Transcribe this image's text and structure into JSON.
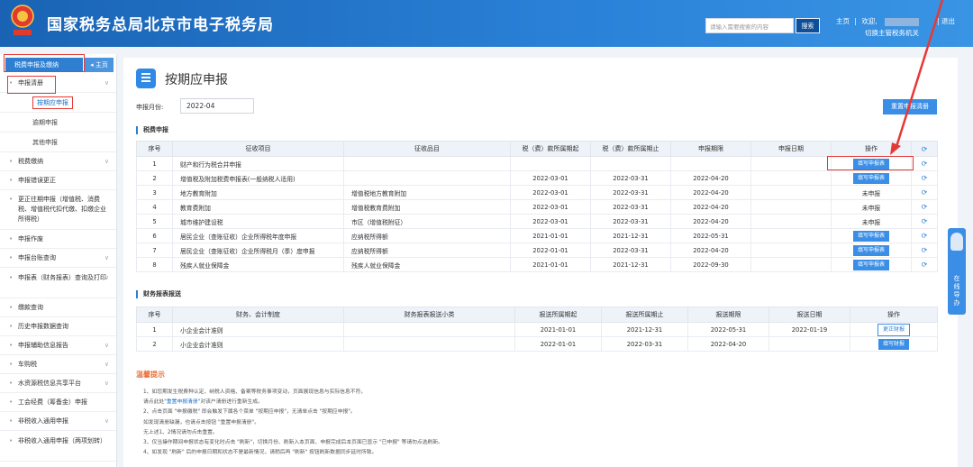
{
  "header": {
    "title": "国家税务总局北京市电子税务局",
    "emblem_text": "中国税务",
    "search_placeholder": "请输入需要搜索的内容",
    "search_button": "搜索",
    "home_link": "主页",
    "welcome": "欢迎,",
    "switch_role": "切换主管税务机关",
    "logout": "退出"
  },
  "sidebar": {
    "main_tab": "税费申报及缴纳",
    "home_tab": "主页",
    "items": [
      {
        "label": "申报清册",
        "expandable": true
      },
      {
        "label": "税费缴纳",
        "expandable": true
      },
      {
        "label": "申报错误更正",
        "expandable": false
      },
      {
        "label": "更正往期申报（增值税、消费税、增值税代扣代缴、扣缴企业所得税）",
        "expandable": false
      },
      {
        "label": "申报作废",
        "expandable": false
      },
      {
        "label": "申报台账查询",
        "expandable": true
      },
      {
        "label": "申报表（财务报表）查询及打印",
        "expandable": true
      },
      {
        "label": "缴款查询",
        "expandable": false
      },
      {
        "label": "历史申报数据查询",
        "expandable": false
      },
      {
        "label": "申报辅助信息报告",
        "expandable": true
      },
      {
        "label": "车购税",
        "expandable": true
      },
      {
        "label": "水资源税信息共享平台",
        "expandable": true
      },
      {
        "label": "工会经费（筹备金）申报",
        "expandable": false
      },
      {
        "label": "非税收入通用申报",
        "expandable": true
      },
      {
        "label": "非税收入通用申报（两项划转）",
        "expandable": false
      }
    ],
    "subitems": [
      "按期应申报",
      "逾期申报",
      "其他申报"
    ],
    "active_subitem": "按期应申报"
  },
  "main": {
    "page_title": "按期应申报",
    "month_label": "申报月份:",
    "month_value": "2022-04",
    "reset_button": "重置申报清册",
    "tax_section_title": "税费申报",
    "tax_table": {
      "headers": [
        "序号",
        "征收项目",
        "征收品目",
        "税（费）款所属期起",
        "税（费）款所属期止",
        "申报期限",
        "申报日期",
        "操作"
      ],
      "rows": [
        {
          "no": "1",
          "item": "财产和行为税合并申报",
          "sub": "",
          "start": "",
          "end": "",
          "deadline": "",
          "date": "",
          "op": "填写申报表",
          "op_type": "button"
        },
        {
          "no": "2",
          "item": "增值税及附加税费申报表(一般纳税人适用)",
          "sub": "",
          "start": "2022-03-01",
          "end": "2022-03-31",
          "deadline": "2022-04-20",
          "date": "",
          "op": "填写申报表",
          "op_type": "button"
        },
        {
          "no": "3",
          "item": "地方教育附加",
          "sub": "增值税地方教育附加",
          "start": "2022-03-01",
          "end": "2022-03-31",
          "deadline": "2022-04-20",
          "date": "",
          "op": "未申报",
          "op_type": "text"
        },
        {
          "no": "4",
          "item": "教育费附加",
          "sub": "增值税教育费附加",
          "start": "2022-03-01",
          "end": "2022-03-31",
          "deadline": "2022-04-20",
          "date": "",
          "op": "未申报",
          "op_type": "text"
        },
        {
          "no": "5",
          "item": "城市维护建设税",
          "sub": "市区（增值税附征）",
          "start": "2022-03-01",
          "end": "2022-03-31",
          "deadline": "2022-04-20",
          "date": "",
          "op": "未申报",
          "op_type": "text"
        },
        {
          "no": "6",
          "item": "居民企业（查账征收）企业所得税年度申报",
          "sub": "应纳税所得额",
          "start": "2021-01-01",
          "end": "2021-12-31",
          "deadline": "2022-05-31",
          "date": "",
          "op": "填写申报表",
          "op_type": "button"
        },
        {
          "no": "7",
          "item": "居民企业（查账征收）企业所得税月（季）度申报",
          "sub": "应纳税所得额",
          "start": "2022-01-01",
          "end": "2022-03-31",
          "deadline": "2022-04-20",
          "date": "",
          "op": "填写申报表",
          "op_type": "button"
        },
        {
          "no": "8",
          "item": "残疾人就业保障金",
          "sub": "残疾人就业保障金",
          "start": "2021-01-01",
          "end": "2021-12-31",
          "deadline": "2022-09-30",
          "date": "",
          "op": "填写申报表",
          "op_type": "button"
        }
      ]
    },
    "fin_section_title": "财务报表报送",
    "fin_table": {
      "headers": [
        "序号",
        "财务、会计制度",
        "财务报表报送小类",
        "报送所属期起",
        "报送所属期止",
        "报送期限",
        "报送日期",
        "操作"
      ],
      "rows": [
        {
          "no": "1",
          "system": "小企业会计准则",
          "sub": "",
          "start": "2021-01-01",
          "end": "2021-12-31",
          "deadline": "2022-05-31",
          "date": "2022-01-19",
          "op": "更正财报",
          "op_type": "white"
        },
        {
          "no": "2",
          "system": "小企业会计准则",
          "sub": "",
          "start": "2022-01-01",
          "end": "2022-03-31",
          "deadline": "2022-04-20",
          "date": "",
          "op": "填写财报",
          "op_type": "button"
        }
      ]
    },
    "tips_title": "温馨提示",
    "tips": [
      "1、如您期发生税费种认定、纳税人资格、备案等税务事项变动，页面展现信息与实际信息不符，",
      "请点此处",
      "\"重置申报清册\"",
      "对该户清册进行重新生成。",
      "2、点击页面 \"申报缴税\" 即会触发下属各个菜单 \"按期应申报\"，无清单点击 \"按期应申报\"。",
      "如发现清册缺漏，也请点击按钮 \"重置申报清册\"。",
      "无上述1、2情况请勿点击重置。",
      "3、仅当操作期间申报状态有变化时点击 \"刷新\"，切换月份、刷新入本页面、申报完成后本页面已显示 \"已申报\" 等请勿点选刷新。",
      "4、如发现 \"刷新\" 后的申报日期和状态不是最新情况，请稍后再 \"刷新\" 按钮刷新数据同步延时所致。"
    ]
  },
  "float": {
    "label": "在线导办"
  }
}
